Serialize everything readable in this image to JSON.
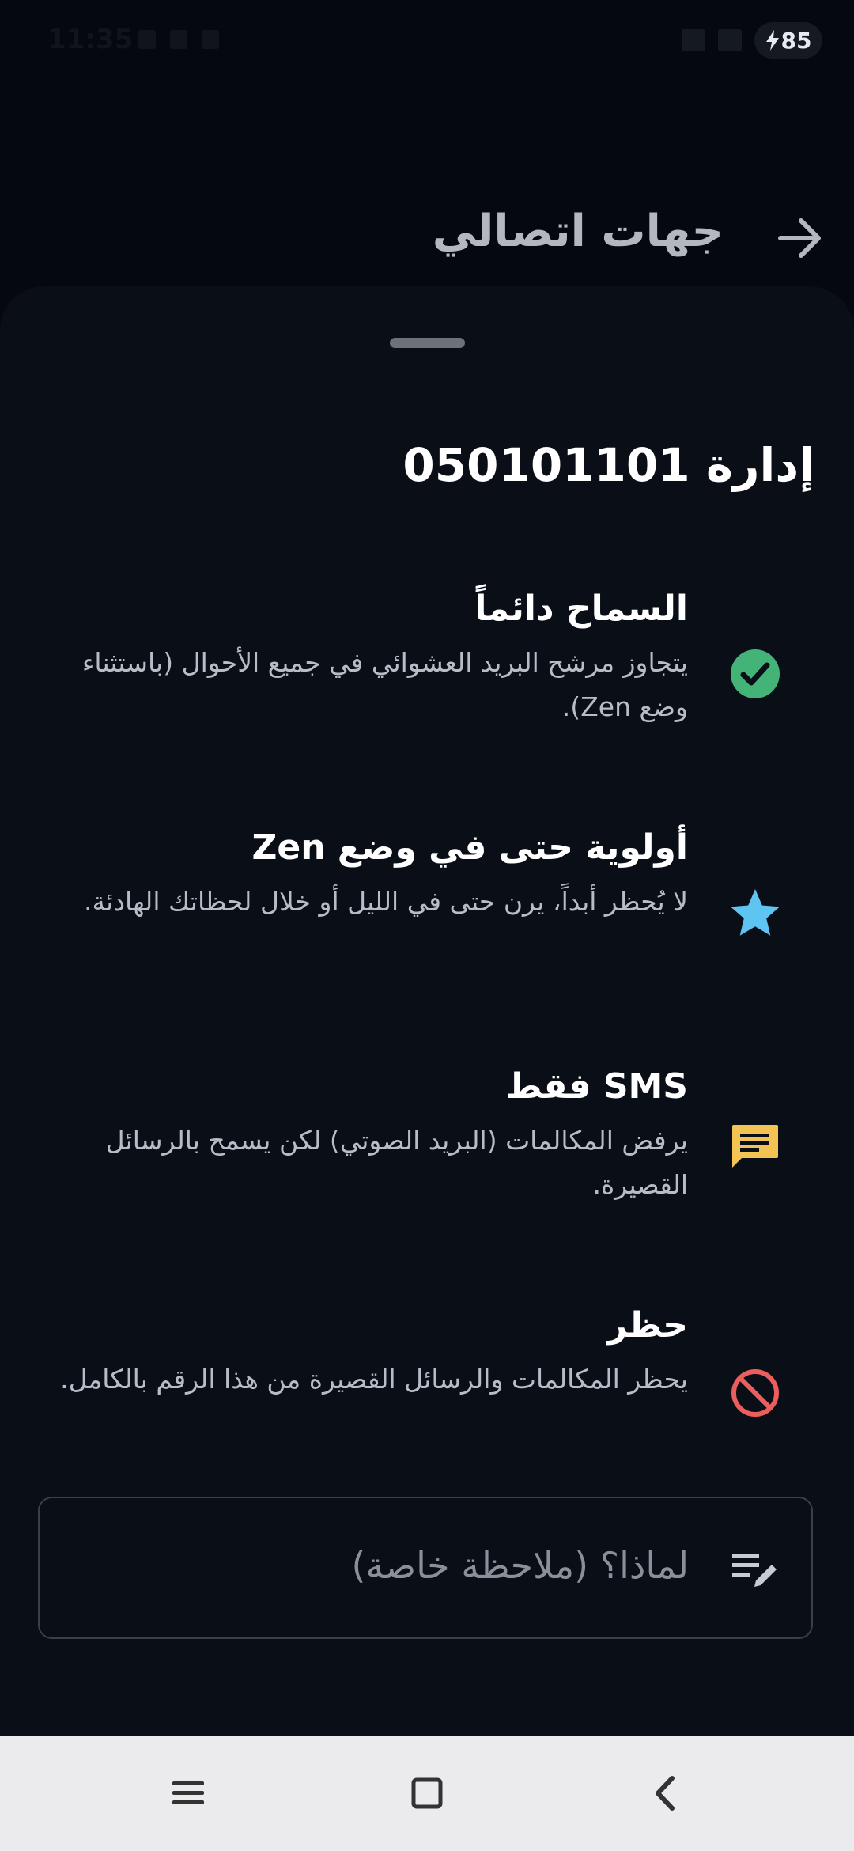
{
  "status_bar": {
    "time": "11:35",
    "battery": "85"
  },
  "header": {
    "title": "جهات اتصالي",
    "back_icon": "arrow-right-icon"
  },
  "sheet": {
    "title": "إدارة 050101101",
    "options": [
      {
        "icon": "check-circle-icon",
        "color": "#44b378",
        "title": "السماح دائماً",
        "description": "يتجاوز مرشح البريد العشوائي في جميع الأحوال (باستثناء وضع Zen)."
      },
      {
        "icon": "star-icon",
        "color": "#5ec5f2",
        "title": "أولوية حتى في وضع Zen",
        "description": "لا يُحظر أبداً، يرن حتى في الليل أو خلال لحظاتك الهادئة."
      },
      {
        "icon": "message-icon",
        "color": "#f3c453",
        "title": "SMS فقط",
        "description": "يرفض المكالمات (البريد الصوتي) لكن يسمح بالرسائل القصيرة."
      },
      {
        "icon": "block-icon",
        "color": "#ec5d5d",
        "title": "حظر",
        "description": "يحظر المكالمات والرسائل القصيرة من هذا الرقم بالكامل."
      }
    ],
    "note": {
      "placeholder": "لماذا؟ (ملاحظة خاصة)",
      "icon": "edit-note-icon"
    }
  },
  "nav_bar": {
    "menu_icon": "menu-icon",
    "home_icon": "home-square-icon",
    "back_icon": "chevron-left-icon"
  }
}
